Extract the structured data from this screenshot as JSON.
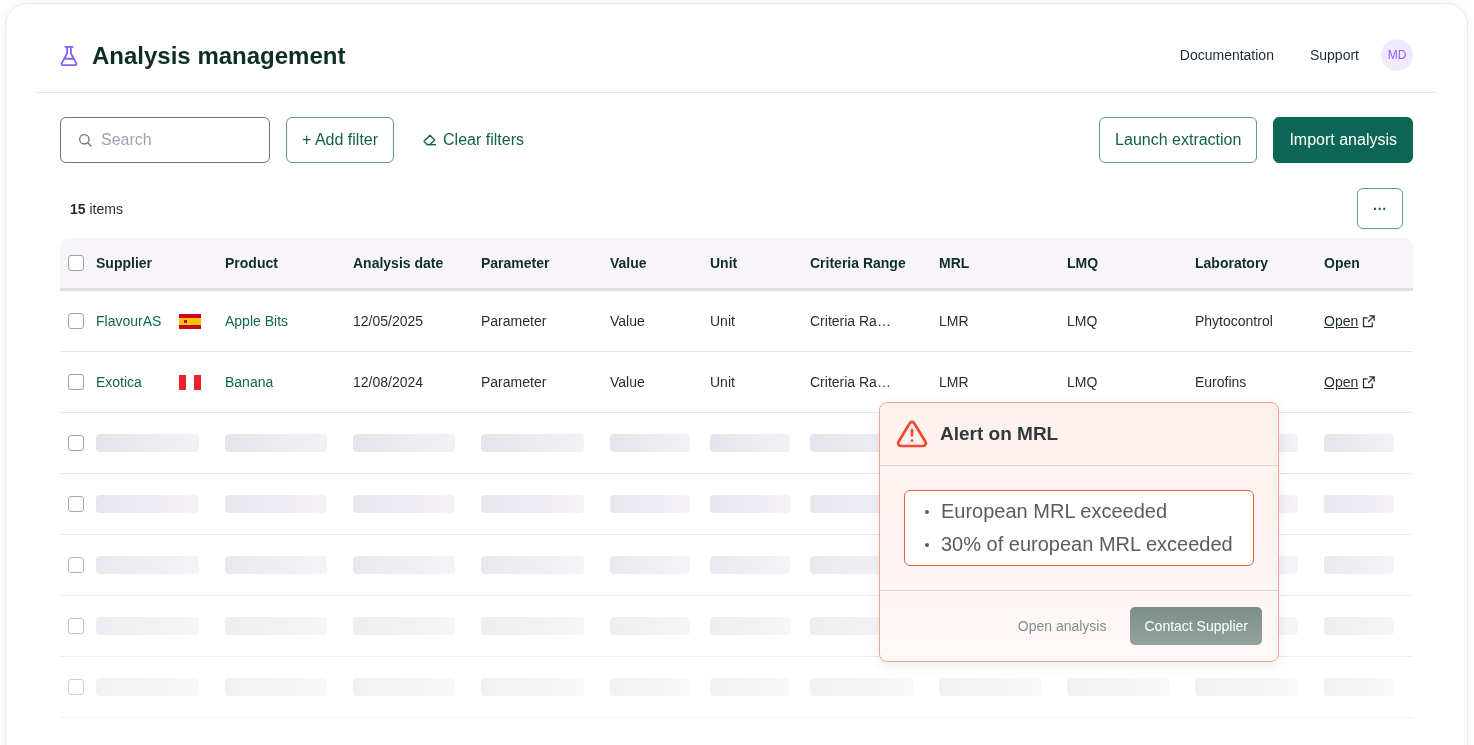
{
  "header": {
    "title": "Analysis management",
    "links": [
      "Documentation",
      "Support"
    ],
    "avatar": "MD"
  },
  "toolbar": {
    "search": {
      "placeholder": "Search"
    },
    "add_filter": "+ Add filter",
    "clear_filters": "Clear filters",
    "buttons": [
      {
        "label": "Launch extraction",
        "kind": "outline"
      },
      {
        "label": "Import analysis",
        "kind": "primary"
      }
    ]
  },
  "summary": {
    "count": "15",
    "label": "items",
    "more": "···"
  },
  "table": {
    "select_all": {
      "checked": false
    },
    "columns": [
      "Supplier",
      "Product",
      "Analysis date",
      "Parameter",
      "Value",
      "Unit",
      "Criteria Range",
      "MRL",
      "LMQ",
      "Laboratory",
      "Open"
    ],
    "rows": [
      {
        "checked": false,
        "supplier": "FlavourAS",
        "kind": "spain",
        "product": "Apple Bits",
        "date": "12/05/2025",
        "parameter": "Parameter",
        "value": "Value",
        "unit": "Unit",
        "criteria": "Criteria Ra…",
        "mrl": "LMR",
        "lmq": "LMQ",
        "laboratory": "Phytocontrol",
        "open": "Open"
      },
      {
        "checked": false,
        "supplier": "Exotica",
        "kind": "peru",
        "product": "Banana",
        "date": "12/08/2024",
        "parameter": "Parameter",
        "value": "Value",
        "unit": "Unit",
        "criteria": "Criteria Ra…",
        "mrl": "LMR",
        "lmq": "LMQ",
        "laboratory": "Eurofins",
        "open": "Open"
      }
    ],
    "loading_rows": [
      {
        "checked": false
      },
      {
        "checked": false
      },
      {
        "checked": false
      },
      {
        "checked": false
      },
      {
        "checked": false
      }
    ]
  },
  "alert": {
    "title": "Alert on MRL",
    "items": [
      "European MRL exceeded",
      "30% of european MRL exceeded"
    ],
    "secondary_action": "Open analysis",
    "primary_action": "Contact Supplier"
  }
}
